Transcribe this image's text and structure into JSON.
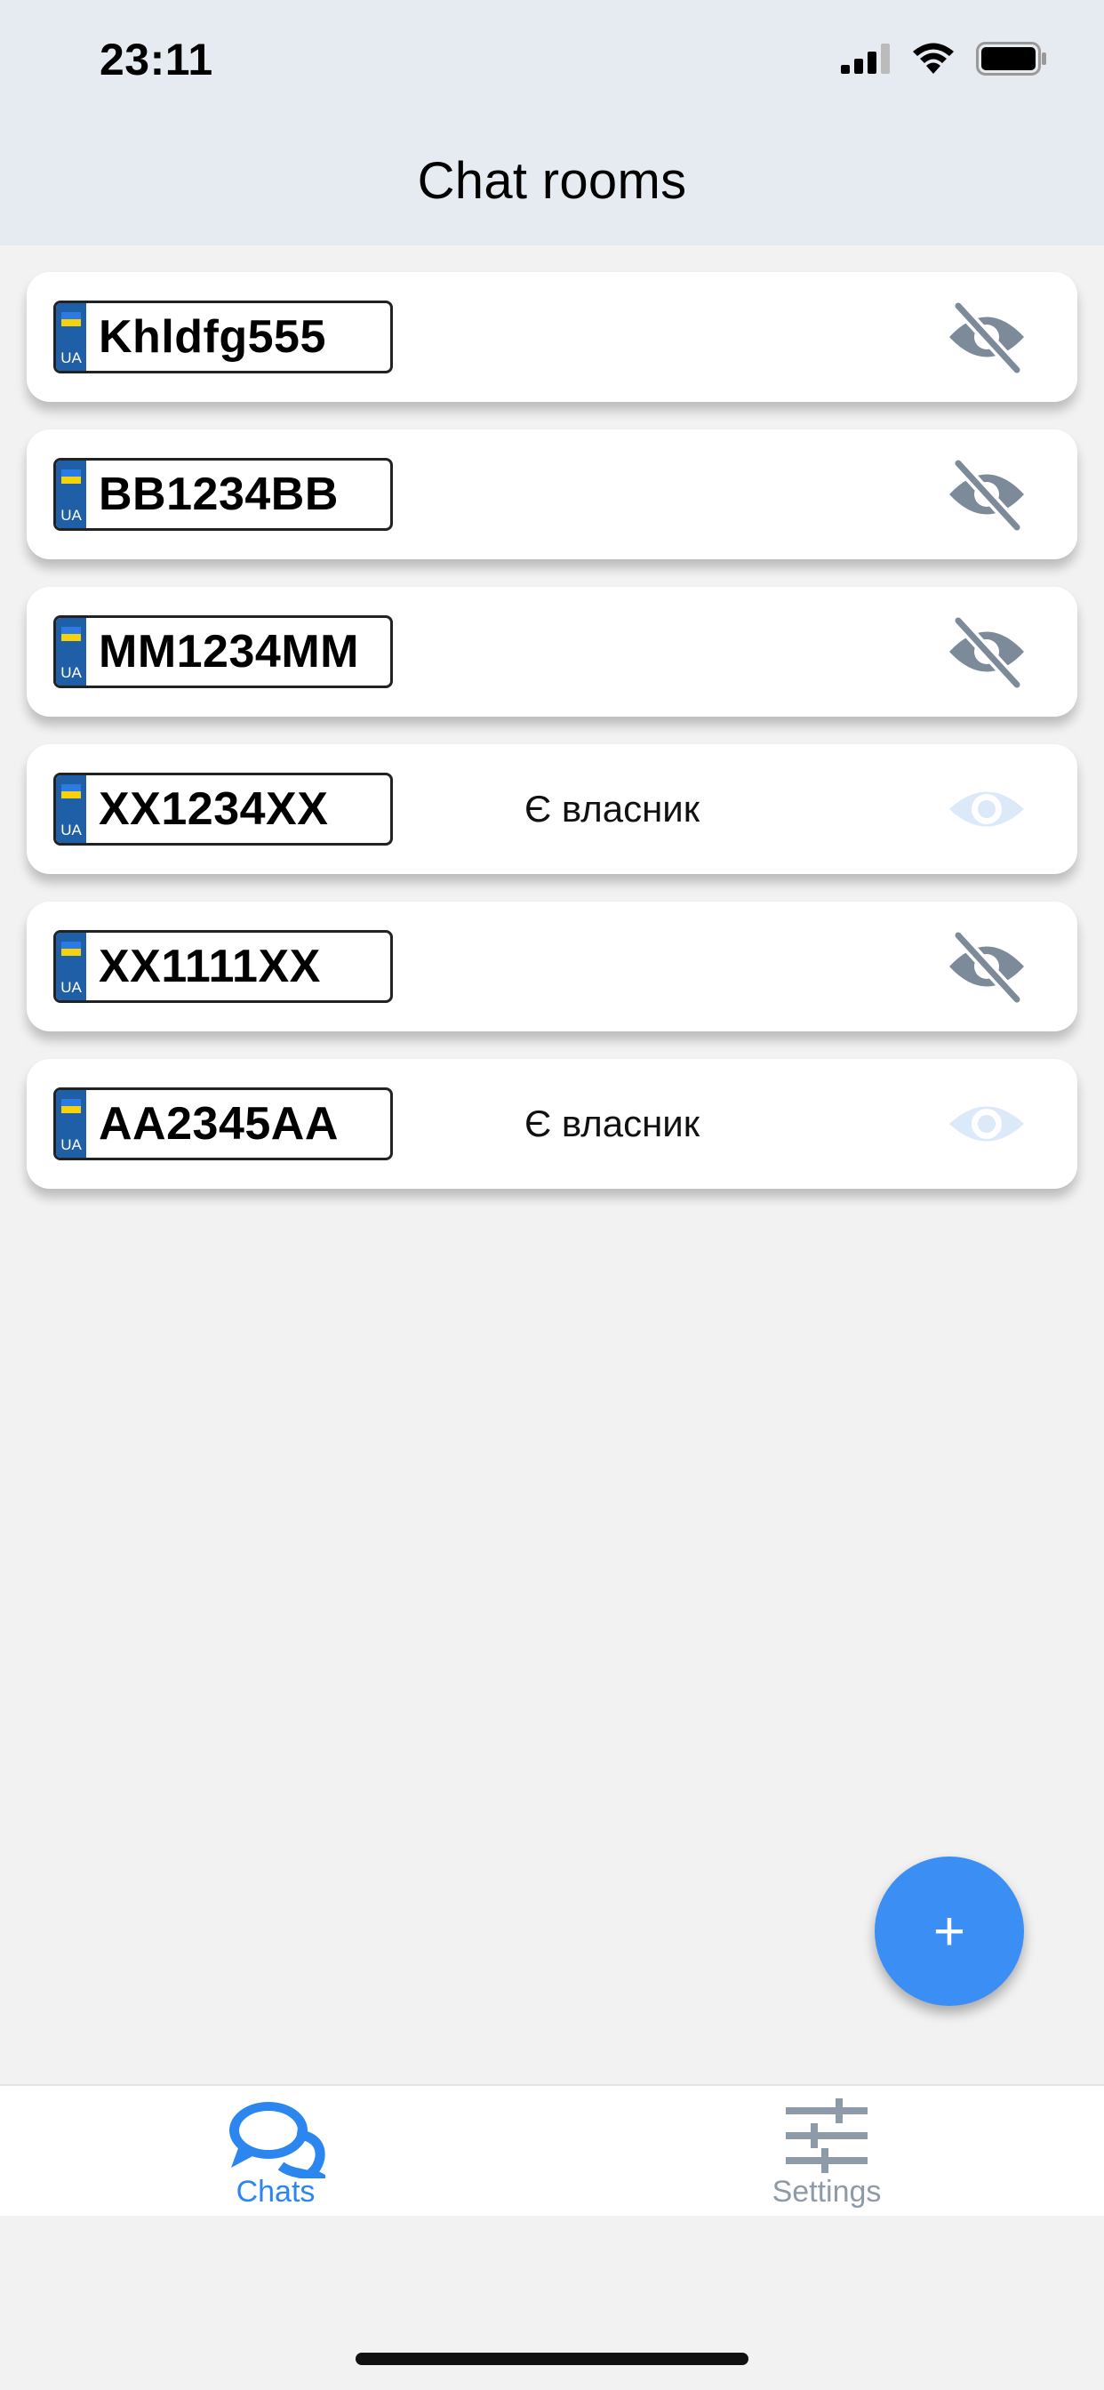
{
  "status_bar": {
    "time": "23:11"
  },
  "header": {
    "title": "Chat rooms"
  },
  "plate_country": "UA",
  "rooms": [
    {
      "plate": "Khldfg555",
      "owner_text": "",
      "visibility": "hidden"
    },
    {
      "plate": "BB1234BB",
      "owner_text": "",
      "visibility": "hidden"
    },
    {
      "plate": "MM1234MM",
      "owner_text": "",
      "visibility": "hidden"
    },
    {
      "plate": "XX1234XX",
      "owner_text": "Є власник",
      "visibility": "visible"
    },
    {
      "plate": "XX1111XX",
      "owner_text": "",
      "visibility": "hidden"
    },
    {
      "plate": "AA2345AA",
      "owner_text": "Є власник",
      "visibility": "visible"
    }
  ],
  "fab": {
    "label": "+"
  },
  "tabs": [
    {
      "label": "Chats",
      "icon": "chat-bubbles-icon",
      "active": true
    },
    {
      "label": "Settings",
      "icon": "sliders-icon",
      "active": false
    }
  ],
  "colors": {
    "accent": "#2b86f0",
    "fab": "#3b8ef3",
    "eye_hidden": "#7d8a99",
    "eye_visible": "#dbe9f8",
    "header_bg": "#e6ebf2"
  }
}
